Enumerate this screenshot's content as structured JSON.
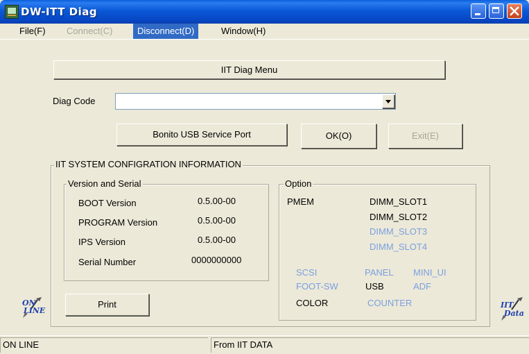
{
  "window": {
    "title": "DW-ITT Diag"
  },
  "menu": [
    {
      "label": "File(F)",
      "state": "normal"
    },
    {
      "label": "Connect(C)",
      "state": "disabled"
    },
    {
      "label": "Disconnect(D)",
      "state": "active"
    },
    {
      "label": "Window(H)",
      "state": "normal"
    }
  ],
  "main": {
    "menu_button": "IIT Diag Menu",
    "diag_code_label": "Diag Code",
    "diag_code_value": "",
    "usb_button": "Bonito USB Service Port",
    "ok_button": "OK(O)",
    "exit_button": "Exit(E)"
  },
  "system_info": {
    "title": "IIT SYSTEM CONFIGRATION INFORMATION",
    "version_group": {
      "title": "Version and Serial",
      "rows": [
        {
          "label": "BOOT Version",
          "value": "0.5.00-00"
        },
        {
          "label": "PROGRAM Version",
          "value": "0.5.00-00"
        },
        {
          "label": "IPS Version",
          "value": "0.5.00-00"
        },
        {
          "label": "Serial Number",
          "value": "0000000000"
        }
      ]
    },
    "option_group": {
      "title": "Option",
      "pmem_label": "PMEM",
      "dimm": [
        {
          "label": "DIMM_SLOT1",
          "enabled": true
        },
        {
          "label": "DIMM_SLOT2",
          "enabled": true
        },
        {
          "label": "DIMM_SLOT3",
          "enabled": false
        },
        {
          "label": "DIMM_SLOT4",
          "enabled": false
        }
      ],
      "options": [
        {
          "label": "SCSI",
          "enabled": false
        },
        {
          "label": "PANEL",
          "enabled": false
        },
        {
          "label": "MINI_UI",
          "enabled": false
        },
        {
          "label": "FOOT-SW",
          "enabled": false
        },
        {
          "label": "USB",
          "enabled": true
        },
        {
          "label": "ADF",
          "enabled": false
        },
        {
          "label": "COLOR",
          "enabled": true
        },
        {
          "label": "COUNTER",
          "enabled": false
        }
      ]
    },
    "print_button": "Print"
  },
  "side_icons": {
    "left": [
      "ON",
      "LINE"
    ],
    "right": [
      "IIT",
      "Data"
    ]
  },
  "status": {
    "left": "ON LINE",
    "right": "From IIT DATA"
  },
  "colors": {
    "titlebar": "#0a58d6",
    "face": "#ece9d8",
    "disabled_option": "#7b9fe0",
    "menu_active": "#316ac5"
  },
  "icons": {
    "app": "diag-app-icon",
    "minimize": "minimize-icon",
    "maximize": "maximize-icon",
    "close": "close-icon",
    "dropdown": "chevron-down-icon"
  }
}
